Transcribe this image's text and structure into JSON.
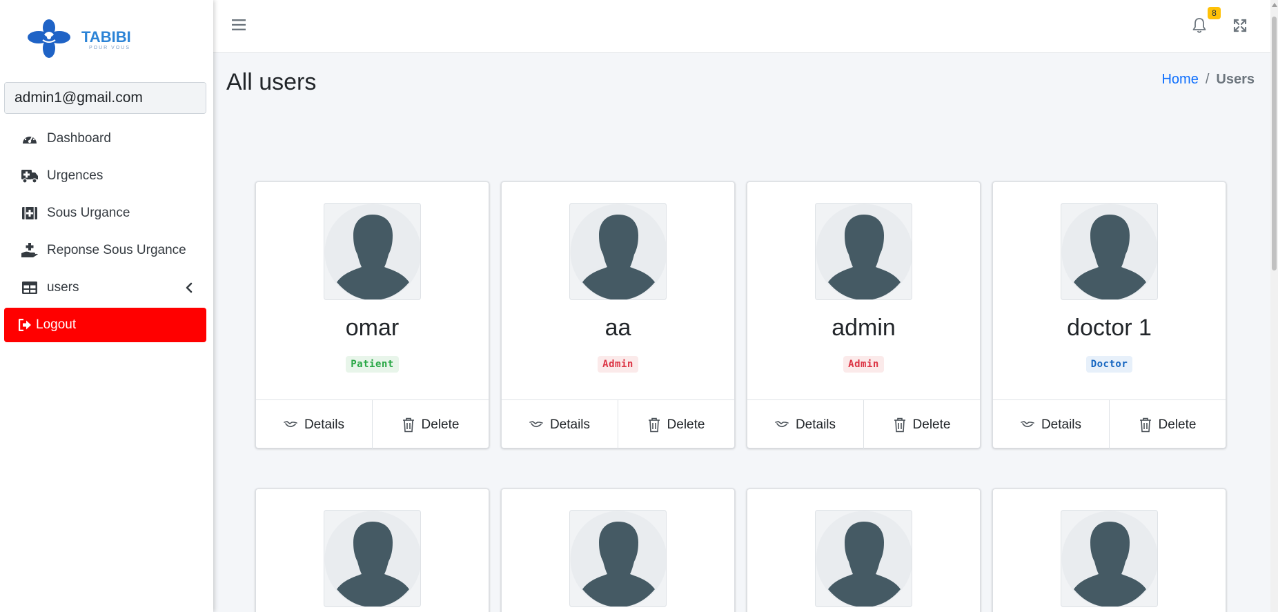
{
  "brand": {
    "name": "TABIBI",
    "tagline": "POUR VOUS"
  },
  "search": {
    "value": "admin1@gmail.com",
    "button_icon": "search-icon"
  },
  "sidebar": {
    "items": [
      {
        "label": "Dashboard",
        "icon": "tachometer-icon"
      },
      {
        "label": "Urgences",
        "icon": "ambulance-icon"
      },
      {
        "label": "Sous Urgance",
        "icon": "first-aid-icon"
      },
      {
        "label": "Reponse Sous Urgance",
        "icon": "hand-holding-medical-icon"
      },
      {
        "label": "users",
        "icon": "table-icon"
      }
    ],
    "logout_label": "Logout"
  },
  "topbar": {
    "notification_count": "8"
  },
  "header": {
    "title": "All users",
    "breadcrumb": {
      "home": "Home",
      "separator": "/",
      "current": "Users"
    }
  },
  "users": [
    {
      "name": "omar",
      "role": "Patient"
    },
    {
      "name": "aa",
      "role": "Admin"
    },
    {
      "name": "admin",
      "role": "Admin"
    },
    {
      "name": "doctor 1",
      "role": "Doctor"
    }
  ],
  "card_actions": {
    "details": "Details",
    "delete": "Delete"
  },
  "colors": {
    "logout_bg": "#ff0000",
    "link": "#0d6efd",
    "badge_patient": "#28a745",
    "badge_admin": "#dc3545",
    "badge_doctor": "#1565c0",
    "notification_badge": "#ffc107",
    "avatar_silhouette": "#455a64"
  }
}
